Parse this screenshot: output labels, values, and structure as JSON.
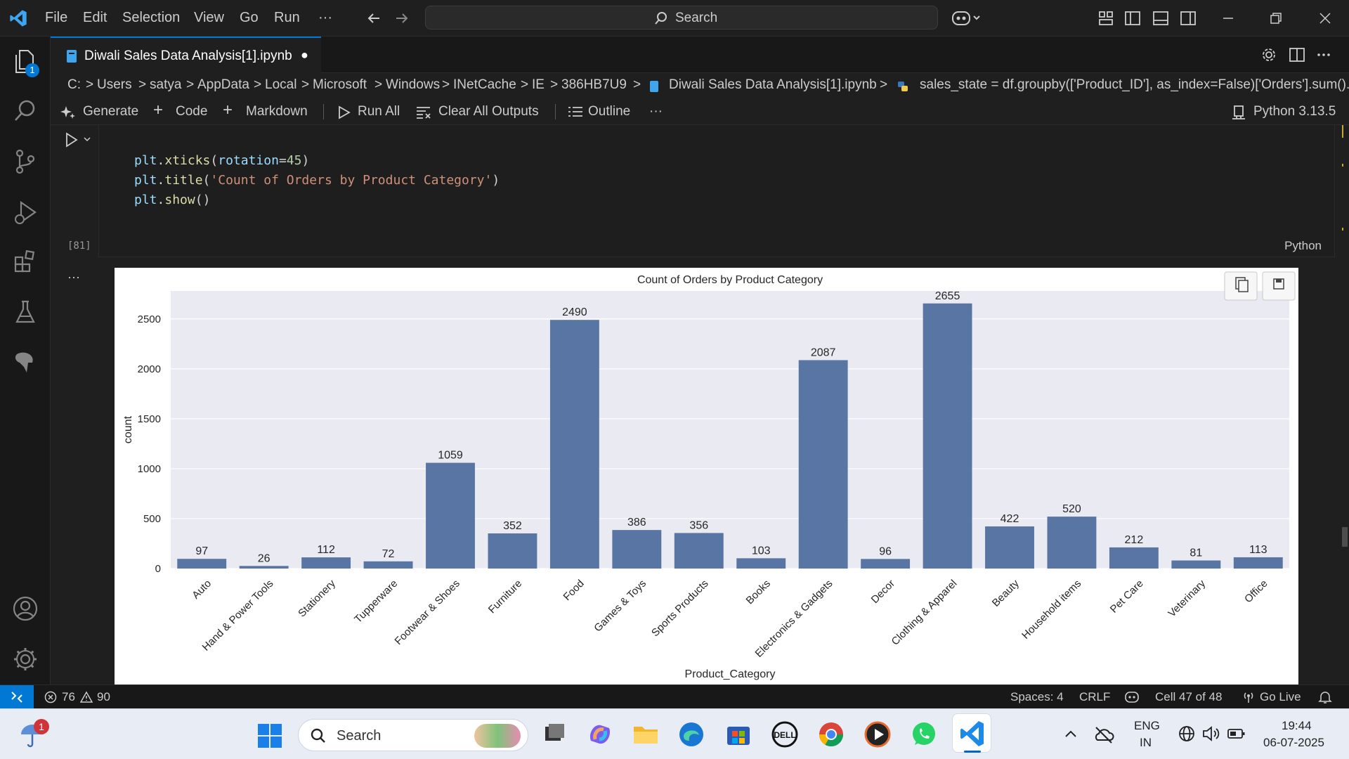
{
  "titlebar": {
    "menu": [
      "File",
      "Edit",
      "Selection",
      "View",
      "Go",
      "Run",
      "···"
    ],
    "search_label": "Search"
  },
  "activity": {
    "explorer_badge": "1"
  },
  "tab": {
    "label": "Diwali Sales Data Analysis[1].ipynb",
    "dirty_dot": "●"
  },
  "breadcrumb": {
    "items": [
      "C:",
      "Users",
      "satya",
      "AppData",
      "Local",
      "Microsoft",
      "Windows",
      "INetCache",
      "IE",
      "386HB7U9",
      "Diwali Sales Data Analysis[1].ipynb",
      "sales_state = df.groupby(['Product_ID'], as_index=False)['Orders'].sum()."
    ],
    "separator": ">"
  },
  "toolbar": {
    "generate": "Generate",
    "code": "Code",
    "markdown": "Markdown",
    "run_all": "Run All",
    "clear_outputs": "Clear All Outputs",
    "outline": "Outline",
    "more": "···",
    "kernel": "Python 3.13.5"
  },
  "cell": {
    "exec_count": "[81]",
    "language": "Python",
    "line1": {
      "obj": "plt",
      "dot": ".",
      "fn": "xticks",
      "open": "(",
      "param": "rotation",
      "eq": "=",
      "num": "45",
      "close": ")"
    },
    "line2": {
      "obj": "plt",
      "dot": ".",
      "fn": "title",
      "open": "(",
      "str": "'Count of Orders by Product Category'",
      "close": ")"
    },
    "line3": {
      "obj": "plt",
      "dot": ".",
      "fn": "show",
      "open": "(",
      "close": ")"
    },
    "output_menu": "···"
  },
  "chart_data": {
    "type": "bar",
    "title": "Count of Orders by Product Category",
    "xlabel": "Product_Category",
    "ylabel": "count",
    "categories": [
      "Auto",
      "Hand & Power Tools",
      "Stationery",
      "Tupperware",
      "Footwear & Shoes",
      "Furniture",
      "Food",
      "Games & Toys",
      "Sports Products",
      "Books",
      "Electronics & Gadgets",
      "Decor",
      "Clothing & Apparel",
      "Beauty",
      "Household items",
      "Pet Care",
      "Veterinary",
      "Office"
    ],
    "values": [
      97,
      26,
      112,
      72,
      1059,
      352,
      2490,
      386,
      356,
      103,
      2087,
      96,
      2655,
      422,
      520,
      212,
      81,
      113
    ],
    "ylim": [
      0,
      2780
    ],
    "yticks": [
      0,
      500,
      1000,
      1500,
      2000,
      2500
    ],
    "grid": true,
    "bar_color": "#5975a4",
    "plot_bg": "#eaeaf2"
  },
  "statusbar": {
    "errors": "76",
    "warnings": "90",
    "spaces": "Spaces: 4",
    "eol": "CRLF",
    "cell_pos": "Cell 47 of 48",
    "go_live": "Go Live"
  },
  "taskbar": {
    "search_label": "Search",
    "lang_line1": "ENG",
    "lang_line2": "IN",
    "time": "19:44",
    "date": "06-07-2025",
    "notif_badge": "1"
  },
  "colors": {
    "accent": "#0078d4",
    "vscode_blue": "#007acc"
  }
}
